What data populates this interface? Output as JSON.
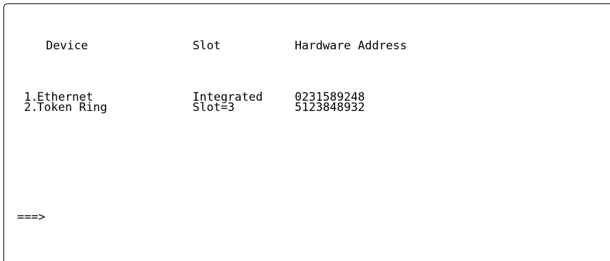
{
  "screen": {
    "header": {
      "device": "Device",
      "slot": "Slot",
      "hardware_address": "Hardware Address"
    },
    "rows": [
      {
        "number": "1.",
        "device": "Ethernet",
        "slot": "Integrated",
        "hardware_address": "0231589248"
      },
      {
        "number": "2.",
        "device": "Token Ring",
        "slot": "Slot=3",
        "hardware_address": "5123848932"
      }
    ],
    "prompt": "===>"
  }
}
